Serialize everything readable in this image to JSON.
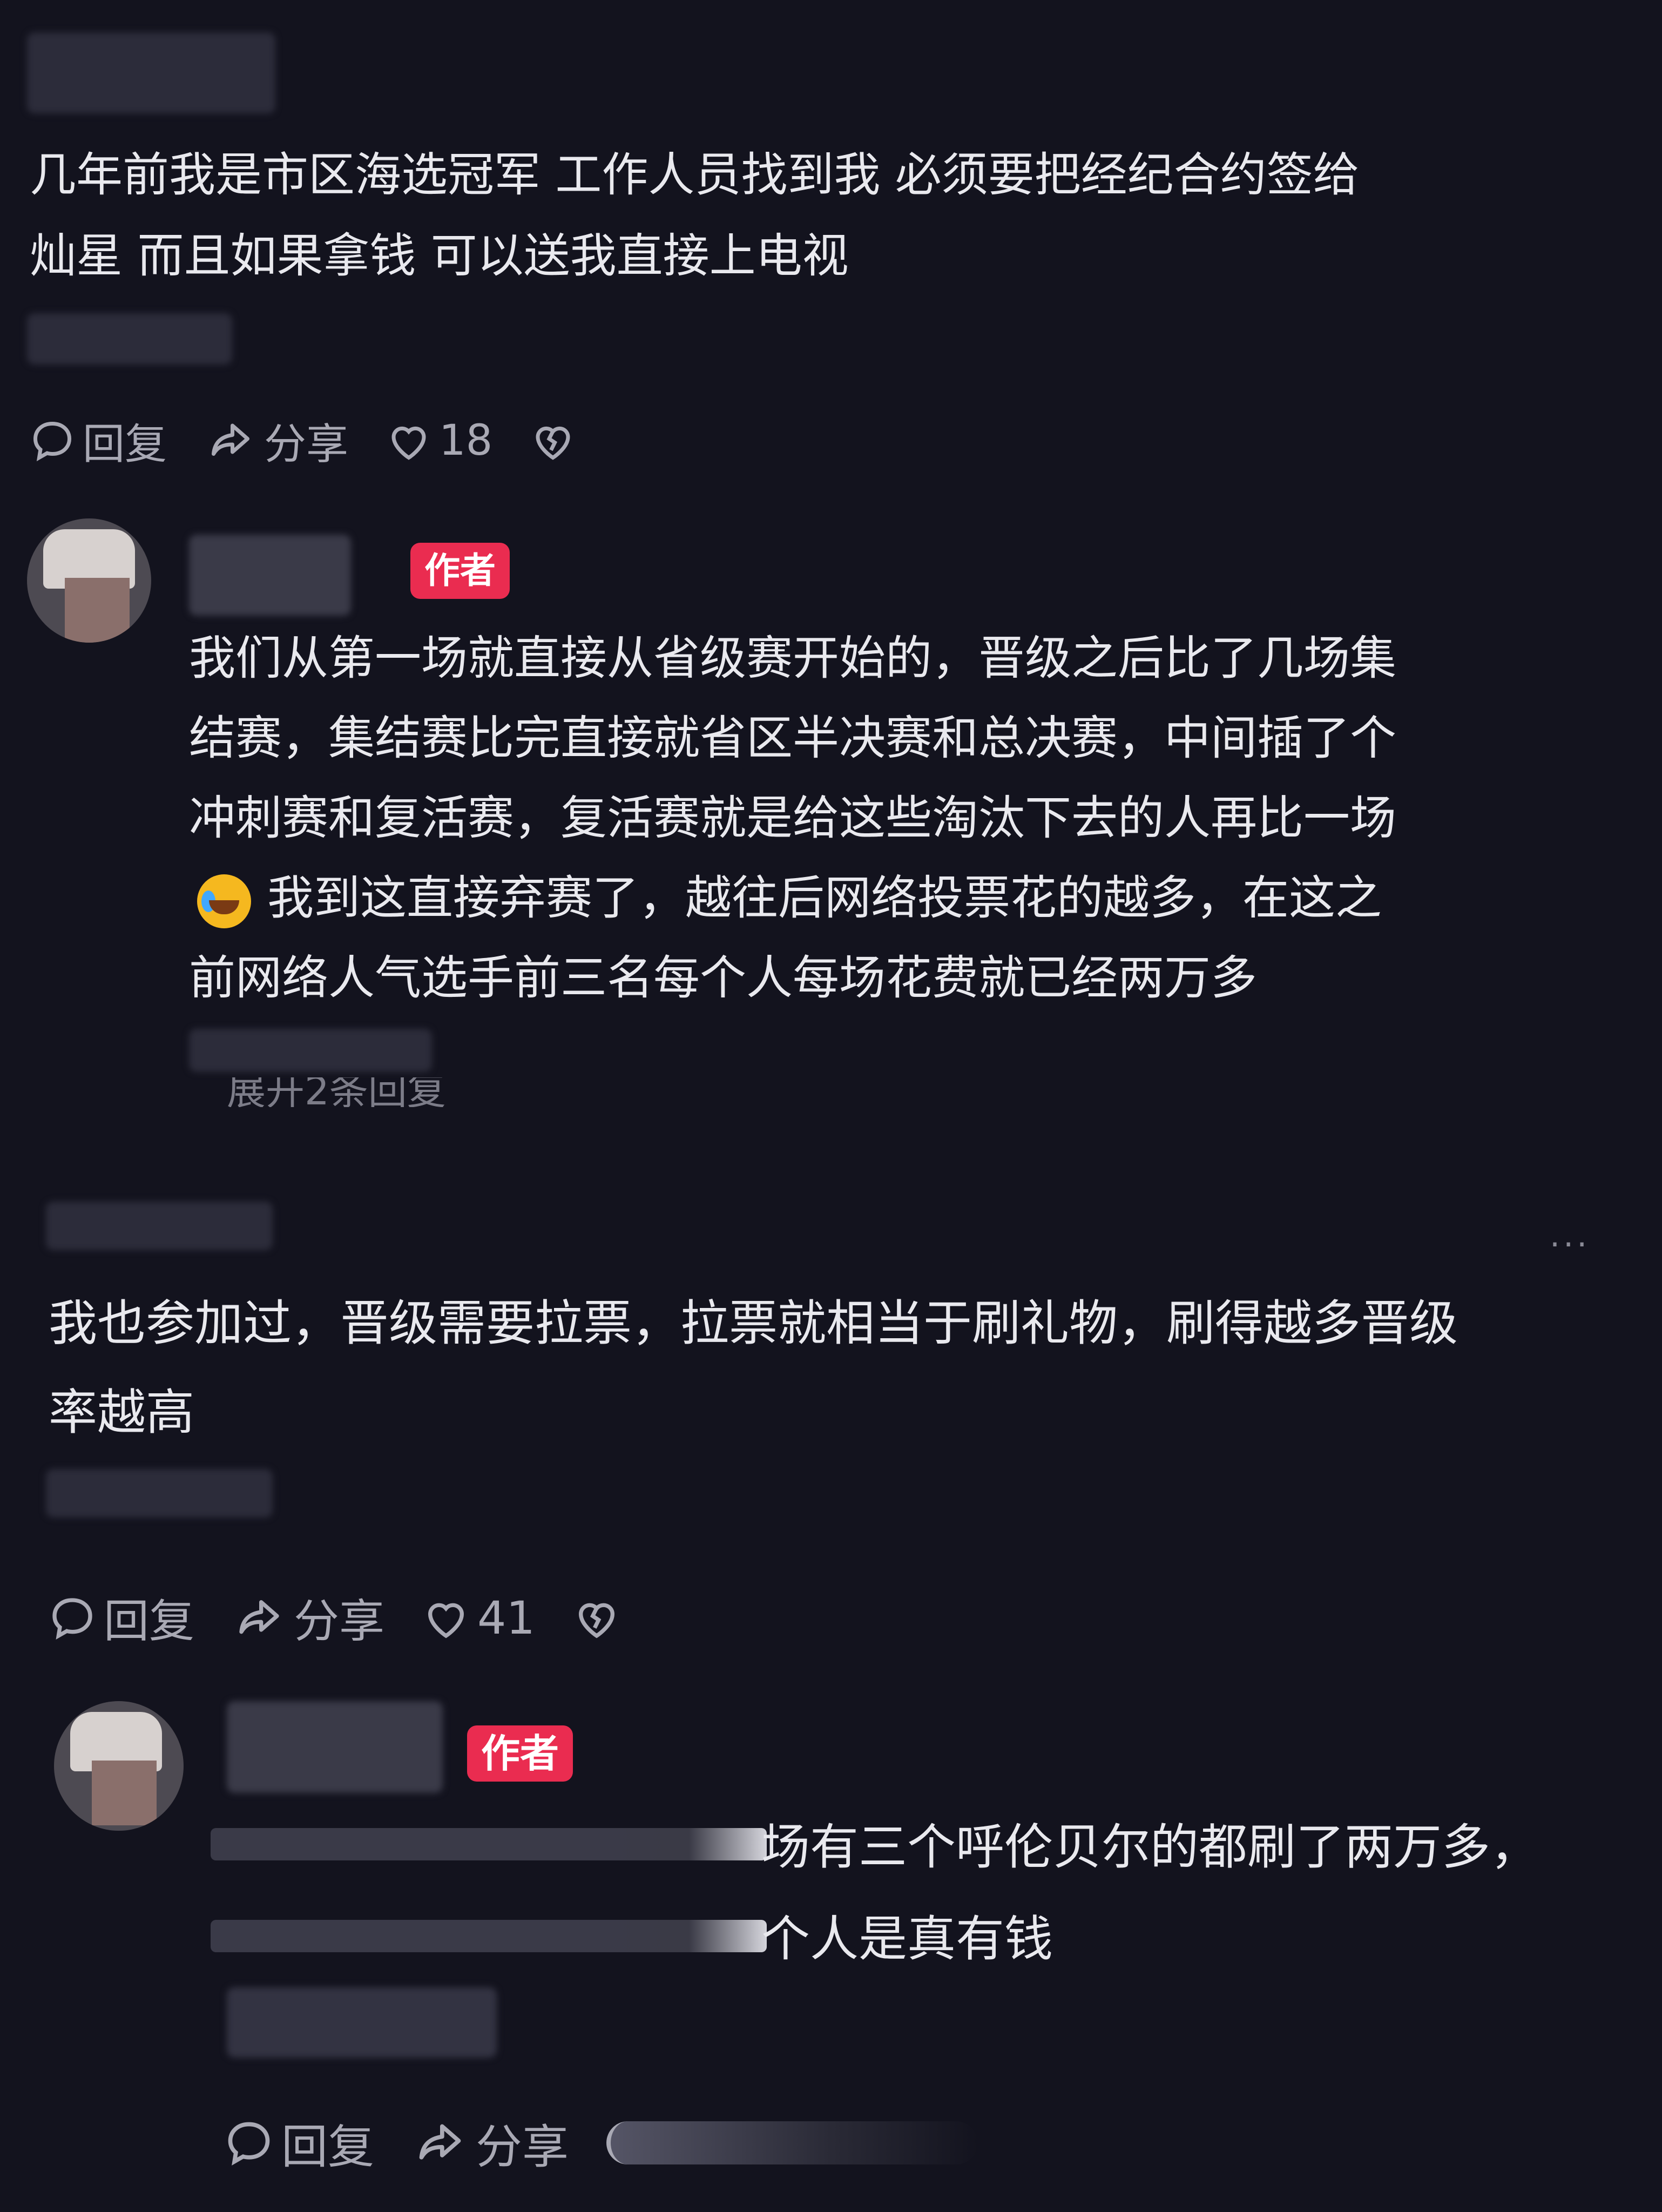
{
  "comments": [
    {
      "text_lines": [
        "几年前我是市区海选冠军 工作人员找到我 必须要把经纪合约签给",
        "灿星 而且如果拿钱 可以送我直接上电视"
      ],
      "actions": {
        "reply": "回复",
        "share": "分享",
        "likes": "18"
      }
    },
    {
      "badge": "作者",
      "text_lines": [
        "我们从第一场就直接从省级赛开始的，晋级之后比了几场集",
        "结赛，集结赛比完直接就省区半决赛和总决赛，中间插了个",
        "冲刺赛和复活赛，复活赛就是给这些淘汰下去的人再比一场",
        "我到这直接弃赛了，越往后网络投票花的越多，在这之",
        "前网络人气选手前三名每个人每场花费就已经两万多"
      ],
      "expand": "展开2条回复"
    },
    {
      "text_lines": [
        "我也参加过，晋级需要拉票，拉票就相当于刷礼物，刷得越多晋级",
        "率越高"
      ],
      "more": "···",
      "actions": {
        "reply": "回复",
        "share": "分享",
        "likes": "41"
      }
    },
    {
      "badge": "作者",
      "text_lines": [
        "场有三个呼伦贝尔的都刷了两万多，",
        "个人是真有钱"
      ],
      "actions": {
        "reply": "回复",
        "share": "分享"
      }
    }
  ]
}
